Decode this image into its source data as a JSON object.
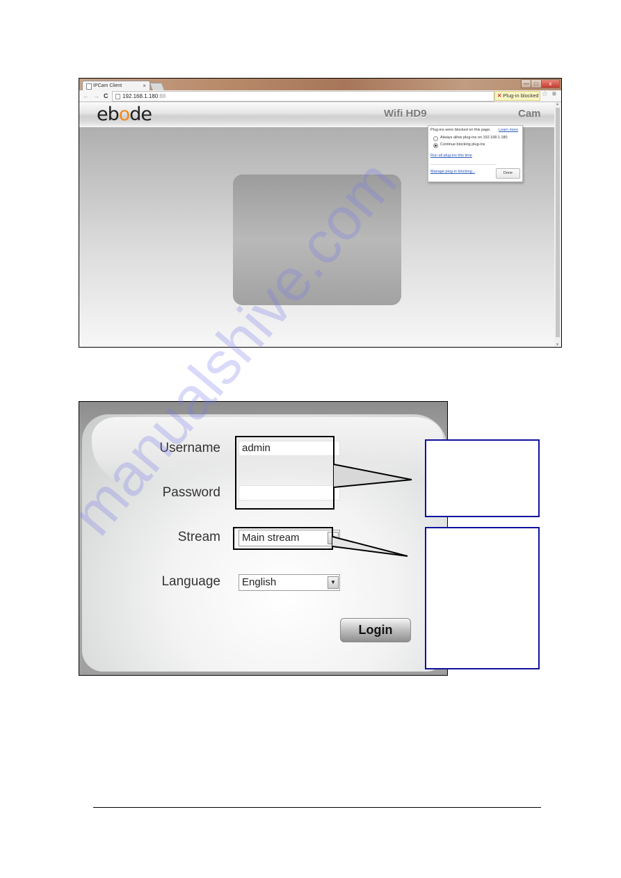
{
  "browser": {
    "tab_title": "IPCam Client",
    "tab_close": "×",
    "window_controls": {
      "minimize": "—",
      "maximize": "□",
      "close": "x"
    },
    "nav": {
      "back": "←",
      "forward": "→",
      "reload": "C"
    },
    "url_host": "192.168.1.180",
    "url_port": ":88",
    "plugin_badge": "Plug-in blocked",
    "plugin_badge_icon": "plugin-blocked-icon",
    "star": "☆",
    "menu": "≡"
  },
  "site": {
    "logo_parts": [
      "eb",
      "o",
      "de"
    ],
    "title_left": "Wifi HD9",
    "title_right": "Cam"
  },
  "plugin_bubble": {
    "title": "Plug-ins were blocked on this page.",
    "learn_more": "Learn more",
    "options": [
      {
        "label": "Always allow plug-ins on 192.168.1.180",
        "selected": false
      },
      {
        "label": "Continue blocking plug-ins",
        "selected": true
      }
    ],
    "run_all": "Run all plug-ins this time",
    "manage": "Manage plug-in blocking...",
    "done": "Done"
  },
  "login": {
    "username_label": "Username",
    "username_value": "admin",
    "password_label": "Password",
    "password_value": "",
    "stream_label": "Stream",
    "stream_value": "Main stream",
    "language_label": "Language",
    "language_value": "English",
    "dropdown_arrow": "▼",
    "login_button": "Login"
  },
  "watermark": "manualshive.com"
}
